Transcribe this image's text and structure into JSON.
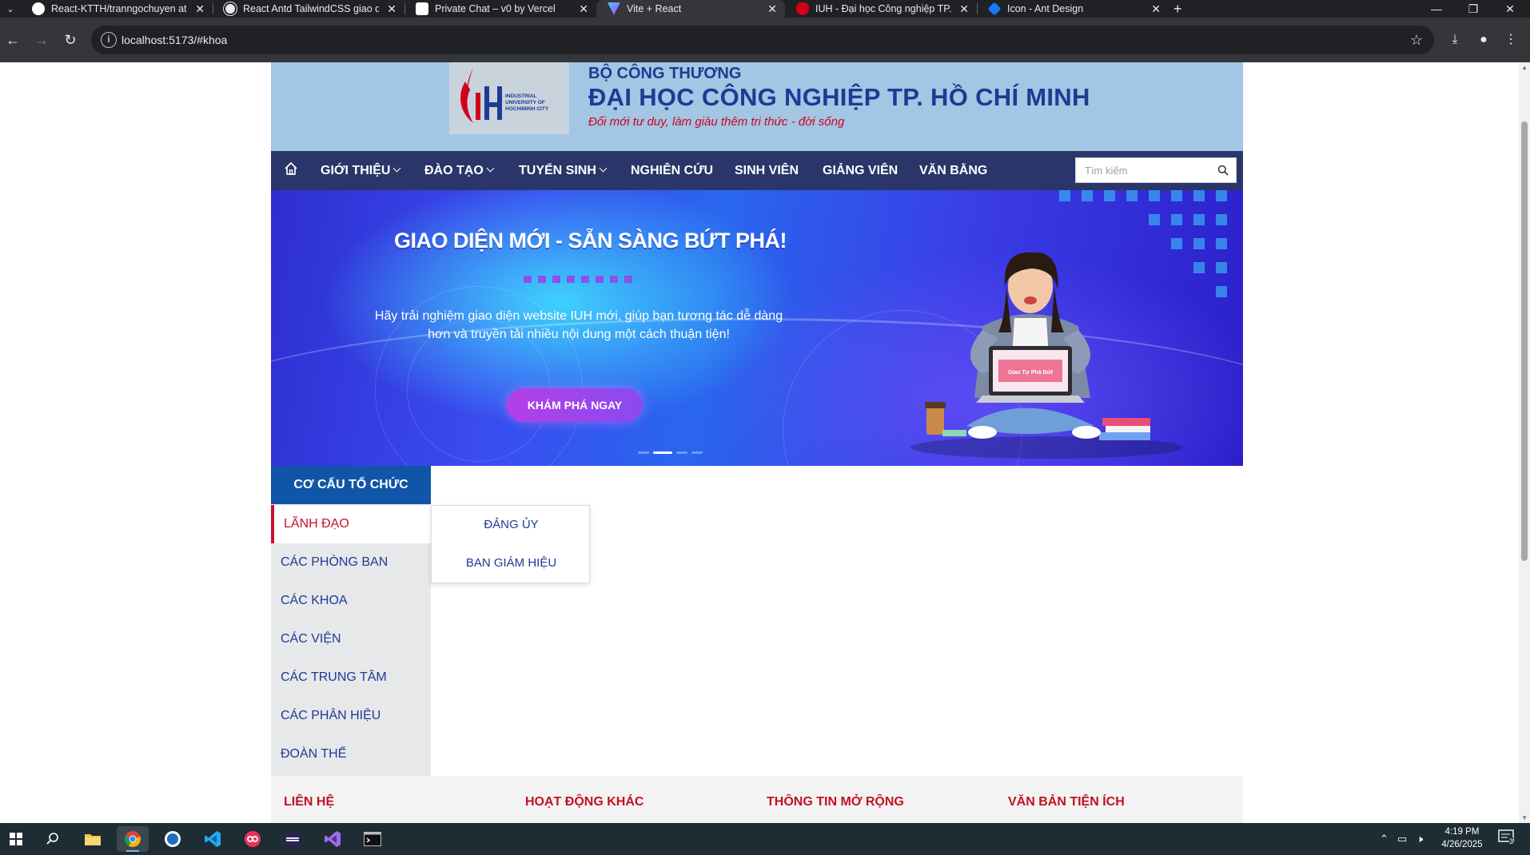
{
  "browser": {
    "tabs": [
      {
        "title": "React-KTTH/tranngochuyen at",
        "active": false
      },
      {
        "title": "React Antd TailwindCSS giao di",
        "active": false
      },
      {
        "title": "Private Chat – v0 by Vercel",
        "active": false
      },
      {
        "title": "Vite + React",
        "active": true
      },
      {
        "title": "IUH - Đại học Công nghiệp TP.",
        "active": false
      },
      {
        "title": "Icon - Ant Design",
        "active": false
      }
    ],
    "url": "localhost:5173/#khoa"
  },
  "header": {
    "logo_text": "INDUSTRIAL UNIVERSITY OF HOCHIMINH CITY",
    "ministry": "BỘ CÔNG THƯƠNG",
    "university": "ĐẠI HỌC CÔNG NGHIỆP TP. HỒ CHÍ MINH",
    "slogan": "Đổi mới tư duy, làm giàu thêm tri thức - đời sống"
  },
  "nav": {
    "items": [
      {
        "label": "GIỚI THIỆU",
        "dropdown": true
      },
      {
        "label": "ĐÀO TẠO",
        "dropdown": true
      },
      {
        "label": "TUYỂN SINH",
        "dropdown": true
      },
      {
        "label": "NGHIÊN CỨU",
        "dropdown": false
      },
      {
        "label": "SINH VIÊN",
        "dropdown": false
      },
      {
        "label": "GIẢNG VIÊN",
        "dropdown": false
      },
      {
        "label": "VĂN BẰNG",
        "dropdown": false
      }
    ],
    "search_placeholder": "Tìm kiếm"
  },
  "banner": {
    "headline": "GIAO DIỆN MỚI - SẴN SÀNG BỨT PHÁ!",
    "description": "Hãy trải nghiệm giao diện website IUH mới, giúp bạn tương tác dễ dàng hơn và truyền tải nhiều nội dung một cách thuận tiện!",
    "cta": "KHÁM PHÁ NGAY",
    "laptop_text": "Giao Tự Phá Bứt",
    "slides_total": 4,
    "active_slide": 2
  },
  "sidebar": {
    "title": "CƠ CẤU TỔ CHỨC",
    "items": [
      {
        "label": "LÃNH ĐẠO",
        "active": true
      },
      {
        "label": "CÁC PHÒNG BAN",
        "active": false
      },
      {
        "label": "CÁC KHOA",
        "active": false
      },
      {
        "label": "CÁC VIỆN",
        "active": false
      },
      {
        "label": "CÁC TRUNG TÂM",
        "active": false
      },
      {
        "label": "CÁC PHÂN HIỆU",
        "active": false
      },
      {
        "label": "ĐOÀN THỂ",
        "active": false
      }
    ]
  },
  "submenu": {
    "items": [
      "ĐẢNG ỦY",
      "BAN GIÁM HIỆU"
    ]
  },
  "footer": {
    "columns": [
      "LIÊN HỆ",
      "HOẠT ĐỘNG KHÁC",
      "THÔNG TIN MỞ RỘNG",
      "VĂN BẢN TIỆN ÍCH"
    ]
  },
  "taskbar": {
    "time": "4:19 PM",
    "date": "4/26/2025",
    "notification_count": "3"
  },
  "colors": {
    "header_bg": "#a3c6e4",
    "nav_bg": "#2a3669",
    "primary_blue": "#1f3a93",
    "accent_red": "#c8102e",
    "sidebar_title_bg": "#1155a8"
  }
}
